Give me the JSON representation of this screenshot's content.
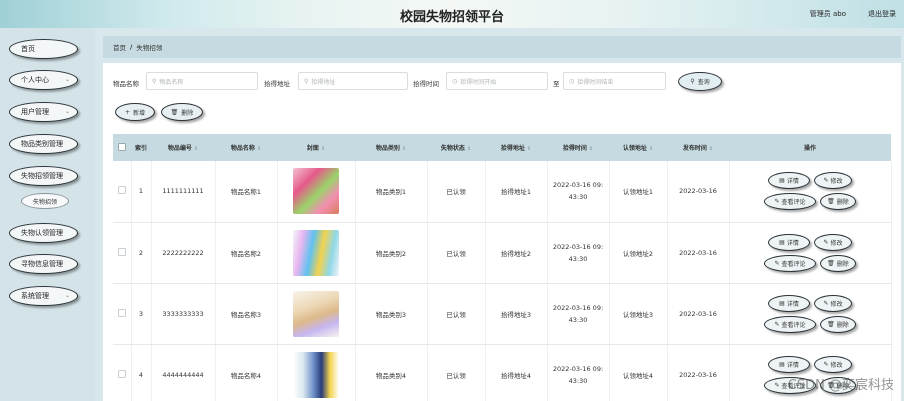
{
  "header": {
    "title": "校园失物招领平台",
    "user": "管理员 abo",
    "logout": "退出登录"
  },
  "sidebar": {
    "items": [
      {
        "label": "首页"
      },
      {
        "label": "个人中心"
      },
      {
        "label": "用户管理"
      },
      {
        "label": "物品类别管理"
      },
      {
        "label": "失物招领管理"
      },
      {
        "label": "失物认领管理"
      },
      {
        "label": "寻物信息管理"
      },
      {
        "label": "系统管理"
      }
    ],
    "sub_item": "失物招领"
  },
  "breadcrumb": {
    "home": "首页",
    "sep": "/",
    "current": "失物招领"
  },
  "search": {
    "name_label": "物品名称",
    "name_placeholder": "物品名称",
    "addr_label": "拾得地址",
    "addr_placeholder": "拾得地址",
    "time_label": "拾得时间",
    "time_start_placeholder": "拾得时间开始",
    "to": "至",
    "time_end_placeholder": "拾得时间结束",
    "query_btn": "查询"
  },
  "actions": {
    "add": "新增",
    "delete": "删除"
  },
  "table": {
    "headers": [
      "索引",
      "物品编号",
      "物品名称",
      "封面",
      "物品类别",
      "失物状态",
      "拾得地址",
      "拾得时间",
      "认领地址",
      "发布时间",
      "操作"
    ],
    "rows": [
      {
        "index": "1",
        "code": "1111111111",
        "name": "物品名称1",
        "category": "物品类别1",
        "status": "已认领",
        "found_addr": "拾得地址1",
        "found_time_date": "2022-03-16 09:",
        "found_time_clock": "43:30",
        "claim_addr": "认领地址1",
        "publish": "2022-03-16"
      },
      {
        "index": "2",
        "code": "2222222222",
        "name": "物品名称2",
        "category": "物品类别2",
        "status": "已认领",
        "found_addr": "拾得地址2",
        "found_time_date": "2022-03-16 09:",
        "found_time_clock": "43:30",
        "claim_addr": "认领地址2",
        "publish": "2022-03-16"
      },
      {
        "index": "3",
        "code": "3333333333",
        "name": "物品名称3",
        "category": "物品类别3",
        "status": "已认领",
        "found_addr": "拾得地址3",
        "found_time_date": "2022-03-16 09:",
        "found_time_clock": "43:30",
        "claim_addr": "认领地址3",
        "publish": "2022-03-16"
      },
      {
        "index": "4",
        "code": "4444444444",
        "name": "物品名称4",
        "category": "物品类别4",
        "status": "已认领",
        "found_addr": "拾得地址4",
        "found_time_date": "2022-03-16 09:",
        "found_time_clock": "43:30",
        "claim_addr": "认领地址4",
        "publish": "2022-03-16"
      }
    ],
    "op_labels": {
      "detail": "详情",
      "edit": "修改",
      "review": "查看评论",
      "delete": "删除"
    }
  },
  "watermark": "CSDN @奕宸科技"
}
